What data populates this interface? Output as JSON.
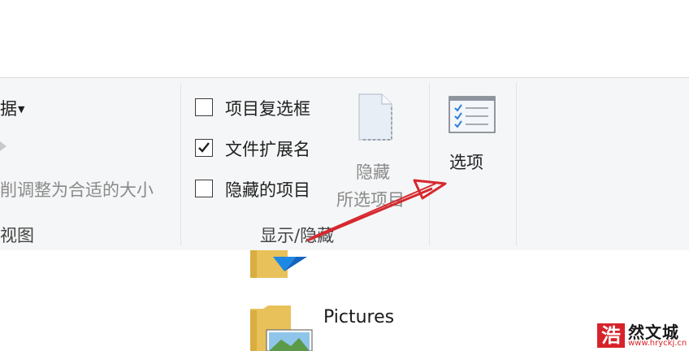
{
  "layout_group": {
    "text_1": "据",
    "text_2": "削调整为合适的大小",
    "group_label": "视图"
  },
  "show_hide": {
    "checkbox_item_label": "项目复选框",
    "checkbox_item_checked": false,
    "checkbox_ext_label": "文件扩展名",
    "checkbox_ext_checked": true,
    "checkbox_hidden_label": "隐藏的项目",
    "checkbox_hidden_checked": false,
    "hide_button_label": "隐藏",
    "hide_button_sublabel": "所选项目",
    "group_label": "显示/隐藏"
  },
  "options": {
    "button_label": "选项"
  },
  "files": {
    "pictures_label": "Pictures"
  },
  "watermark": {
    "seal_char": "浩",
    "name": "然文城",
    "url": "www.hryckj.cn"
  },
  "colors": {
    "arrow": "#d6282e",
    "folder": "#e8c15a",
    "blue_overlay": "#1e88e5",
    "options_check": "#2f7fd6"
  }
}
